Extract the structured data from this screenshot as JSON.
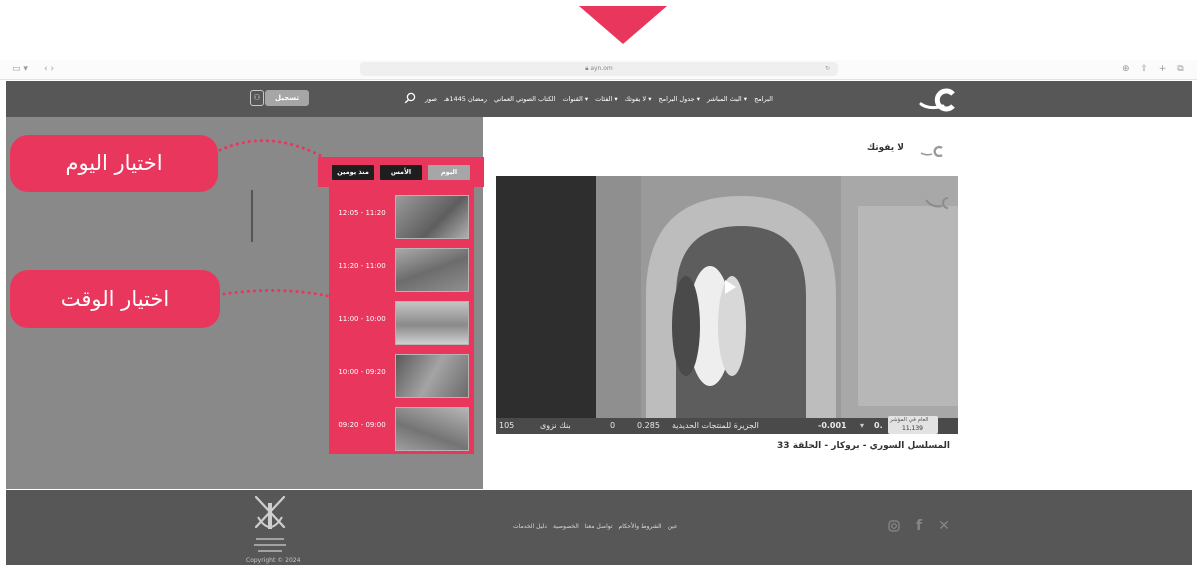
{
  "browser": {
    "url": "ayn.om",
    "sidebar_icon": "sidebar-icon",
    "nav_arrows": "‹ ›",
    "right_icons": "⊕ ⇧ + ⧉"
  },
  "header": {
    "login_label": "تسجيل",
    "nav_items": [
      "البرامج",
      "البث المباشر ▾",
      "جدول البرامج ▾",
      "لا يفوتك ▾",
      "الفئات ▾",
      "القنوات ▾",
      "الكتاب الصوتي العماني",
      "رمضان 1445هـ",
      "صور"
    ]
  },
  "callouts": {
    "select_day": "اختيار اليوم",
    "select_time": "اختيار الوقت"
  },
  "schedule": {
    "tabs": {
      "today": "اليوم",
      "yesterday": "الأمس",
      "two_days_ago": "منذ يومين"
    },
    "slots": [
      {
        "time": "12:05 - 11:20"
      },
      {
        "time": "11:20 - 11:00"
      },
      {
        "time": "11:00 - 10:00"
      },
      {
        "time": "10:00 - 09:20"
      },
      {
        "time": "09:20 - 09:00"
      }
    ]
  },
  "content": {
    "section_title": "لا يفوتك",
    "ticker": {
      "left_value": "105",
      "bank": "بنك نزوى",
      "zero": "0",
      "v285": "0.285",
      "headline": "الجزيرة للمنتجات الحديدية",
      "change": "-0.001",
      "index_label": "العام في المؤشر",
      "index_value": "11,139"
    },
    "caption": "المسلسل السوري - بروكار - الحلقة 33"
  },
  "footer": {
    "links": [
      "عين",
      "الشروط والأحكام",
      "تواصل معنا",
      "الخصوصية",
      "دليل الخدمات"
    ],
    "copyright": "Copyright © 2024",
    "emblem_text": "سلطنة عُمان وزارة الإعلام"
  },
  "colors": {
    "accent": "#e8365d",
    "header": "#575757",
    "panel_gray": "#898989"
  }
}
